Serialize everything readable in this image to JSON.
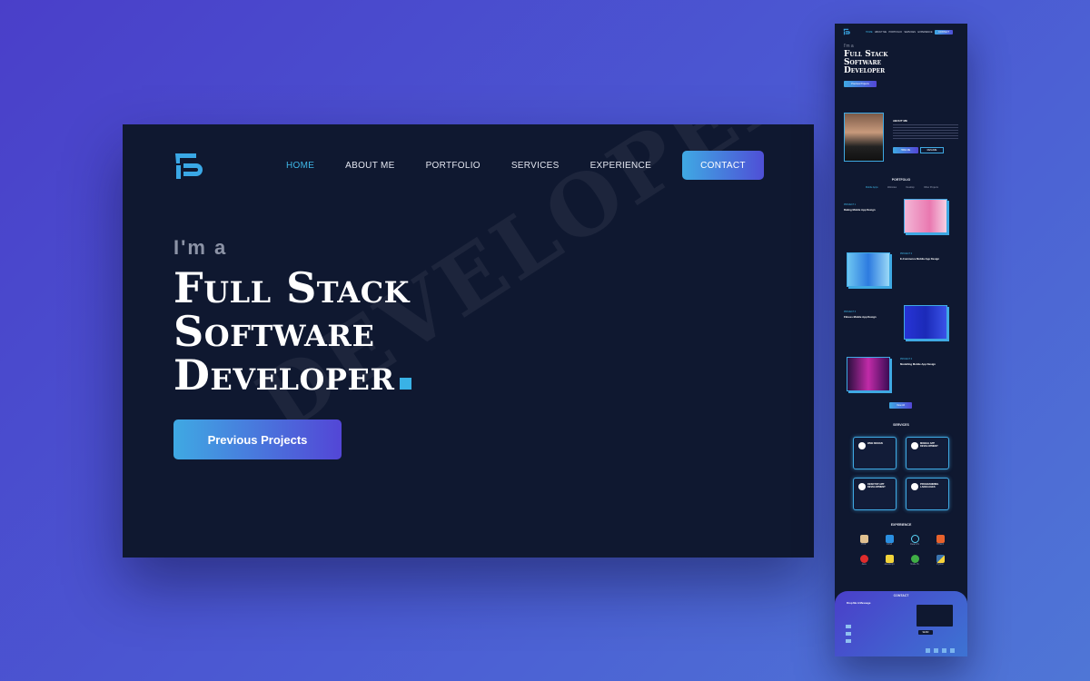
{
  "desktop": {
    "watermark": "DEVELOPER",
    "nav": [
      {
        "label": "HOME",
        "active": true
      },
      {
        "label": "ABOUT ME"
      },
      {
        "label": "PORTFOLIO"
      },
      {
        "label": "SERVICES"
      },
      {
        "label": "EXPERIENCE"
      }
    ],
    "contact_label": "CONTACT",
    "hero": {
      "pre": "I'm a",
      "line1": "Full Stack",
      "line2": "Software",
      "line3": "Developer",
      "cta": "Previous Projects"
    },
    "colors": {
      "accent": "#3fb8e8",
      "background": "#0f1830",
      "gradient_end": "#5346d6"
    }
  },
  "mobile": {
    "nav": [
      "HOME",
      "ABOUT ME",
      "PORTFOLIO",
      "SERVICES",
      "EXPERIENCE",
      "CONTACT"
    ],
    "hero": {
      "pre": "I'm a",
      "title": [
        "Full Stack",
        "Software",
        "Developer"
      ],
      "cta": "Previous Projects"
    },
    "about_heading": "ABOUT ME",
    "about_buttons": [
      "HIRE ME",
      "RESUME"
    ],
    "portfolio_heading": "PORTFOLIO",
    "portfolio_tabs": [
      "Mobile Apps",
      "Websites",
      "Desktop",
      "Other Projects"
    ],
    "projects": [
      {
        "label": "PROJECT 1",
        "title": "Dating Mobile App Design"
      },
      {
        "label": "PROJECT 2",
        "title": "E-Commerce Mobile App Design"
      },
      {
        "label": "PROJECT 3",
        "title": "Fitness Mobile App Design"
      },
      {
        "label": "PROJECT 4",
        "title": "Modelling Mobile App Design"
      }
    ],
    "view_all": "View All",
    "services_heading": "SERVICES",
    "services": [
      "WEB DESIGN",
      "MOBILE APP DEVELOPMENT",
      "DESKTOP APP DEVELOPMENT",
      "PROGRAMMING LANGUAGES"
    ],
    "experience_heading": "EXPERIENCE",
    "experience": [
      "PHP",
      "CSS3",
      "React JS",
      "HTML5",
      "Java",
      "JavaScript",
      "Node JS",
      "Python"
    ],
    "contact_heading": "CONTACT",
    "contact_title": "Drop Me A Message",
    "send": "SEND"
  }
}
